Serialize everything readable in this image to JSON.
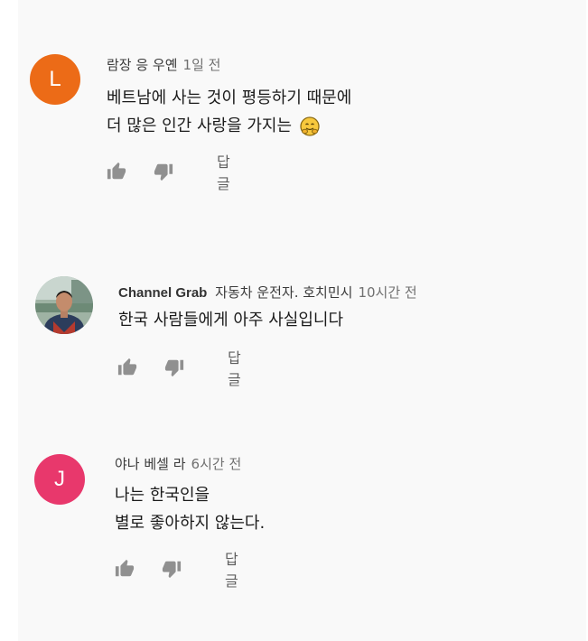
{
  "comments": [
    {
      "avatar_letter": "L",
      "avatar_color": "#ec6b17",
      "author": "람장 응 우옌",
      "time": "1일 전",
      "lines": [
        "베트남에 사는 것이 평등하기 때문에",
        "더 많은 인간 사랑을 가지는"
      ],
      "emoji": "hugging-face-emoji",
      "reply_label": "답글"
    },
    {
      "avatar_letter": "",
      "avatar_color": "",
      "author": "Channel Grab",
      "author_suffix": "자동차 운전자. 호치민시",
      "time": "10시간 전",
      "lines": [
        "한국 사람들에게 아주 사실입니다"
      ],
      "reply_label": "답글"
    },
    {
      "avatar_letter": "J",
      "avatar_color": "#e8386c",
      "author": "야나 베셀 라",
      "time": "6시간 전",
      "lines": [
        "나는 한국인을",
        "별로 좋아하지 않는다."
      ],
      "reply_label": "답글"
    }
  ],
  "icons": {
    "like": "thumbs-up-icon",
    "dislike": "thumbs-down-icon"
  }
}
